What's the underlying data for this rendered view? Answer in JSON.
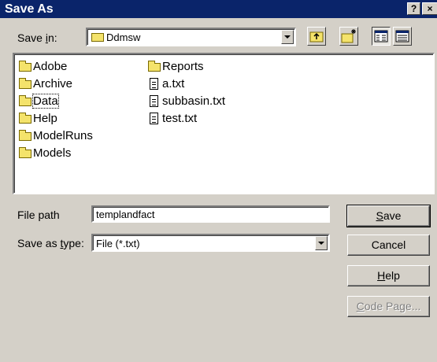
{
  "window": {
    "title": "Save As",
    "help_button": "?",
    "close_button": "×"
  },
  "location": {
    "label_prefix": "Save ",
    "label_accel": "i",
    "label_suffix": "n:",
    "current_folder": "Ddmsw"
  },
  "toolbar": {
    "icons": [
      "up-one-level-icon",
      "create-new-folder-icon",
      "list-view-icon",
      "details-view-icon"
    ],
    "active_view": "list-view"
  },
  "files": {
    "column1": [
      {
        "name": "Adobe",
        "type": "folder"
      },
      {
        "name": "Archive",
        "type": "folder"
      },
      {
        "name": "Data",
        "type": "folder",
        "focused": true
      },
      {
        "name": "Help",
        "type": "folder"
      },
      {
        "name": "ModelRuns",
        "type": "folder"
      },
      {
        "name": "Models",
        "type": "folder"
      }
    ],
    "column2": [
      {
        "name": "Reports",
        "type": "folder"
      },
      {
        "name": "a.txt",
        "type": "file"
      },
      {
        "name": "subbasin.txt",
        "type": "file"
      },
      {
        "name": "test.txt",
        "type": "file"
      }
    ]
  },
  "file_path": {
    "label": "File path",
    "value": "templandfact"
  },
  "save_type": {
    "label_prefix": "Save as ",
    "label_accel": "t",
    "label_suffix": "ype:",
    "value": "File (*.txt)"
  },
  "buttons": {
    "save_accel": "S",
    "save_rest": "ave",
    "cancel": "Cancel",
    "help_accel": "H",
    "help_rest": "elp",
    "codepage_accel": "C",
    "codepage_rest": "ode Page..."
  },
  "colors": {
    "titlebar": "#0a246a",
    "dialog_bg": "#d4d0c8",
    "folder": "#f4e36b"
  }
}
